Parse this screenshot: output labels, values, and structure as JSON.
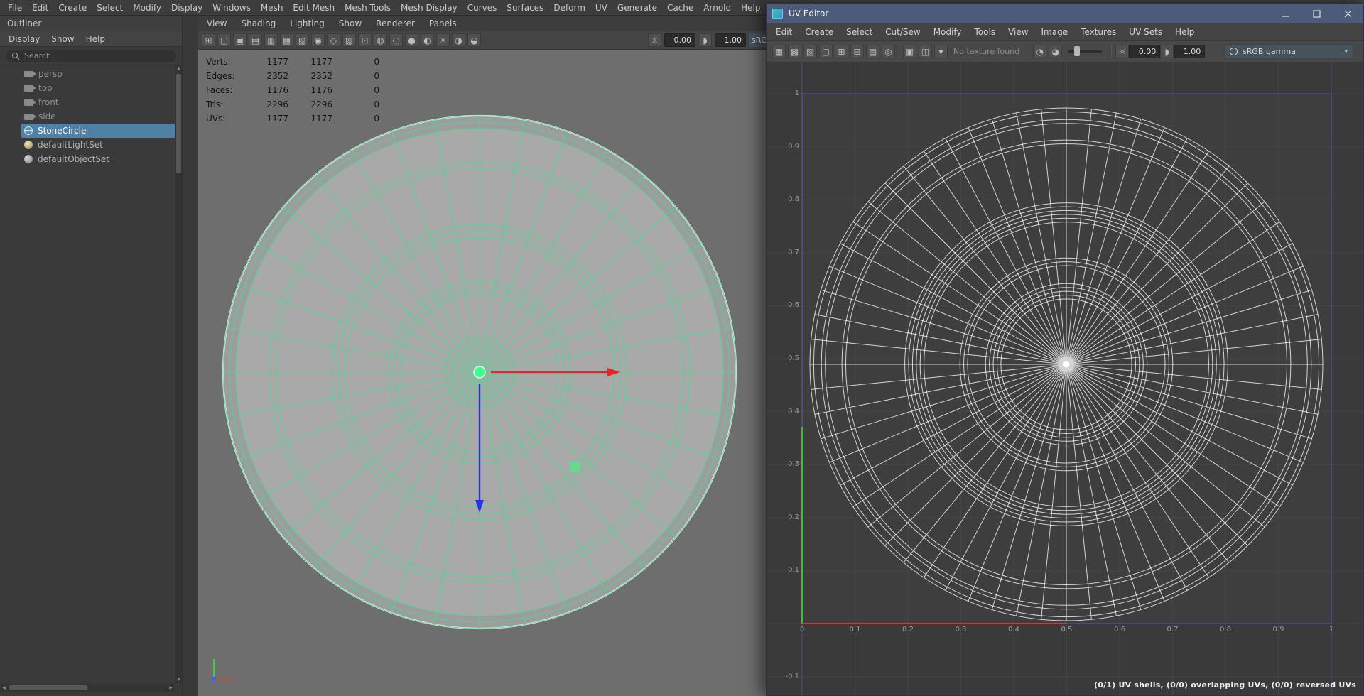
{
  "colors": {
    "selection_highlight": "#4f81a5",
    "wireframe_green": "#44dd8d",
    "uv_wireframe": "#ffffff",
    "manipulator_x": "#ee2222",
    "manipulator_z": "#2233ee",
    "manipulator_center": "#3cff92",
    "uv_titlebar": "#4d5b7a",
    "axis_u": "#c24040",
    "axis_v": "#3fbf3f",
    "grid_border": "#5b5bc4"
  },
  "maya": {
    "menubar": [
      "File",
      "Edit",
      "Create",
      "Select",
      "Modify",
      "Display",
      "Windows",
      "Mesh",
      "Edit Mesh",
      "Mesh Tools",
      "Mesh Display",
      "Curves",
      "Surfaces",
      "Deform",
      "UV",
      "Generate",
      "Cache",
      "Arnold",
      "Help"
    ],
    "outliner": {
      "title": "Outliner",
      "menus": [
        "Display",
        "Show",
        "Help"
      ],
      "search_placeholder": "Search...",
      "items": [
        {
          "label": "persp",
          "type": "camera",
          "selected": false
        },
        {
          "label": "top",
          "type": "camera",
          "selected": false
        },
        {
          "label": "front",
          "type": "camera",
          "selected": false
        },
        {
          "label": "side",
          "type": "camera",
          "selected": false
        },
        {
          "label": "StoneCircle",
          "type": "mesh",
          "selected": true
        },
        {
          "label": "defaultLightSet",
          "type": "lightset",
          "selected": false
        },
        {
          "label": "defaultObjectSet",
          "type": "objectset",
          "selected": false
        }
      ]
    },
    "viewport": {
      "panel_menus": [
        "View",
        "Shading",
        "Lighting",
        "Show",
        "Renderer",
        "Panels"
      ],
      "toolbar": {
        "exposure": "0.00",
        "gamma": "1.00",
        "view_transform": "sRGB"
      },
      "toolbar_icons": [
        {
          "name": "grid-icon",
          "glyph": "⊞"
        },
        {
          "name": "film-gate-icon",
          "glyph": "▢"
        },
        {
          "name": "resolution-gate-icon",
          "glyph": "▣"
        },
        {
          "name": "gate-mask-icon",
          "glyph": "▤"
        },
        {
          "name": "field-chart-icon",
          "glyph": "▥"
        },
        {
          "name": "safe-action-icon",
          "glyph": "▦"
        },
        {
          "name": "safe-title-icon",
          "glyph": "▧"
        },
        {
          "name": "camera-attributes-icon",
          "glyph": "◉"
        },
        {
          "name": "bookmarks-icon",
          "glyph": "◇"
        },
        {
          "name": "image-plane-icon",
          "glyph": "▨"
        },
        {
          "name": "two-d-pan-zoom-icon",
          "glyph": "⊡"
        },
        {
          "name": "oversampling-icon",
          "glyph": "◍"
        },
        {
          "name": "wireframe-display-icon",
          "glyph": "◌"
        },
        {
          "name": "smooth-shade-icon",
          "glyph": "●"
        },
        {
          "name": "textured-display-icon",
          "glyph": "◐"
        },
        {
          "name": "use-all-lights-icon",
          "glyph": "☀"
        },
        {
          "name": "shadows-icon",
          "glyph": "◑"
        },
        {
          "name": "xray-icon",
          "glyph": "◒"
        }
      ],
      "hud": [
        {
          "label": "Verts:",
          "values": [
            "1177",
            "1177",
            "0"
          ]
        },
        {
          "label": "Edges:",
          "values": [
            "2352",
            "2352",
            "0"
          ]
        },
        {
          "label": "Faces:",
          "values": [
            "1176",
            "1176",
            "0"
          ]
        },
        {
          "label": "Tris:",
          "values": [
            "2296",
            "2296",
            "0"
          ]
        },
        {
          "label": "UVs:",
          "values": [
            "1177",
            "1177",
            "0"
          ]
        }
      ]
    }
  },
  "uv_editor": {
    "title": "UV Editor",
    "menus": [
      "Edit",
      "Create",
      "Select",
      "Cut/Sew",
      "Modify",
      "Tools",
      "View",
      "Image",
      "Textures",
      "UV Sets",
      "Help"
    ],
    "toolbar": {
      "texture_status": "No texture found",
      "exposure": "0.00",
      "gamma": "1.00",
      "view_transform": "sRGB gamma"
    },
    "toolbar_icons_left": [
      {
        "name": "uv-distortion-icon",
        "glyph": "▦"
      },
      {
        "name": "uv-checker-icon",
        "glyph": "▩"
      },
      {
        "name": "uv-shade-shells-icon",
        "glyph": "▨"
      },
      {
        "name": "uv-borders-icon",
        "glyph": "▢"
      },
      {
        "name": "uv-grid-icon",
        "glyph": "⊞"
      },
      {
        "name": "uv-pixel-snap-icon",
        "glyph": "⊟"
      },
      {
        "name": "uv-tiles-icon",
        "glyph": "▤"
      },
      {
        "name": "isolate-select-icon",
        "glyph": "◎"
      }
    ],
    "toolbar_icons_mid": [
      {
        "name": "image-display-icon",
        "glyph": "▣"
      },
      {
        "name": "image-ratio-icon",
        "glyph": "◫"
      },
      {
        "name": "texture-options-caret-icon",
        "glyph": "▾"
      }
    ],
    "toolbar_icons_exposure": [
      {
        "name": "dim-image-icon",
        "glyph": "◔"
      },
      {
        "name": "brighten-image-icon",
        "glyph": "◕"
      }
    ],
    "y_axis_labels": [
      {
        "label": "1",
        "v": 1
      },
      {
        "label": "0.9",
        "v": 0.9
      },
      {
        "label": "0.8",
        "v": 0.8
      },
      {
        "label": "0.7",
        "v": 0.7
      },
      {
        "label": "0.6",
        "v": 0.6
      },
      {
        "label": "0.5",
        "v": 0.5
      },
      {
        "label": "0.4",
        "v": 0.4
      },
      {
        "label": "0.3",
        "v": 0.3
      },
      {
        "label": "0.2",
        "v": 0.2
      },
      {
        "label": "0.1",
        "v": 0.1
      },
      {
        "label": "-0.1",
        "v": -0.1
      }
    ],
    "x_axis_labels": [
      {
        "label": "0",
        "u": 0
      },
      {
        "label": "0.1",
        "u": 0.1
      },
      {
        "label": "0.2",
        "u": 0.2
      },
      {
        "label": "0.3",
        "u": 0.3
      },
      {
        "label": "0.4",
        "u": 0.4
      },
      {
        "label": "0.5",
        "u": 0.5
      },
      {
        "label": "0.6",
        "u": 0.6
      },
      {
        "label": "0.7",
        "u": 0.7
      },
      {
        "label": "0.8",
        "u": 0.8
      },
      {
        "label": "0.9",
        "u": 0.9
      },
      {
        "label": "1",
        "u": 1
      }
    ],
    "status": "(0/1) UV shells, (0/0) overlapping UVs, (0/0) reversed UVs"
  },
  "meshes": {
    "viewport": {
      "spokes": 36,
      "spoke_inner": 0.03,
      "rings": [
        1.0,
        0.975,
        0.95,
        0.82,
        0.795,
        0.575,
        0.55,
        0.525,
        0.355,
        0.33,
        0.305,
        0.135,
        0.105
      ]
    },
    "uv": {
      "spokes": 64,
      "spoke_inner": 0.004,
      "rings": [
        1.0,
        0.985,
        0.955,
        0.94,
        0.875,
        0.86,
        0.63,
        0.615,
        0.6,
        0.585,
        0.57,
        0.555,
        0.415,
        0.4,
        0.385,
        0.315,
        0.3,
        0.285,
        0.27,
        0.255
      ]
    }
  }
}
